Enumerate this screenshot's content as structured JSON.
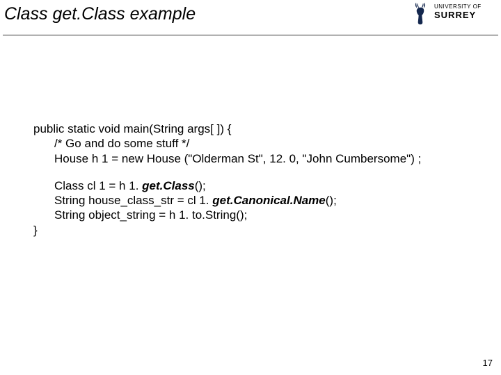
{
  "header": {
    "title": "Class get.Class example",
    "logo": {
      "line1": "UNIVERSITY OF",
      "line2": "SURREY"
    }
  },
  "code": {
    "l1": "public static void main(String args[ ]) {",
    "l2": "/* Go and do some stuff */",
    "l3": "House h 1 = new House (\"Olderman St\", 12. 0, \"John Cumbersome\") ;",
    "l4a": "Class cl 1 = h 1. ",
    "l4b": "get.Class",
    "l4c": "();",
    "l5a": "String house_class_str = cl 1. ",
    "l5b": "get.Canonical.Name",
    "l5c": "();",
    "l6": "String object_string = h 1. to.String();",
    "l7": "}"
  },
  "page": "17"
}
